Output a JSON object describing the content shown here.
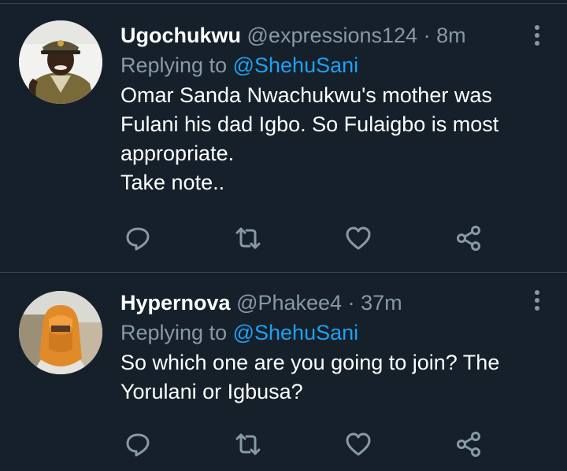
{
  "tweets": [
    {
      "name": "Ugochukwu",
      "handle": "@expressions124",
      "separator": "·",
      "time": "8m",
      "replying_prefix": "Replying to",
      "replying_to": "@ShehuSani",
      "body": "Omar Sanda Nwachukwu's mother was Fulani his dad Igbo. So Fulaigbo is most appropriate.\nTake note.."
    },
    {
      "name": "Hypernova",
      "handle": "@Phakee4",
      "separator": "·",
      "time": "37m",
      "replying_prefix": "Replying to",
      "replying_to": "@ShehuSani",
      "body": "So which one are you going to join? The Yorulani or Igbusa?"
    }
  ],
  "icons": {
    "reply": "reply-icon",
    "retweet": "retweet-icon",
    "like": "heart-icon",
    "share": "share-icon",
    "more": "more-vertical-icon"
  },
  "colors": {
    "background": "#15202b",
    "secondary_text": "#8899a6",
    "accent": "#1da1f2",
    "divider": "#38444d"
  }
}
